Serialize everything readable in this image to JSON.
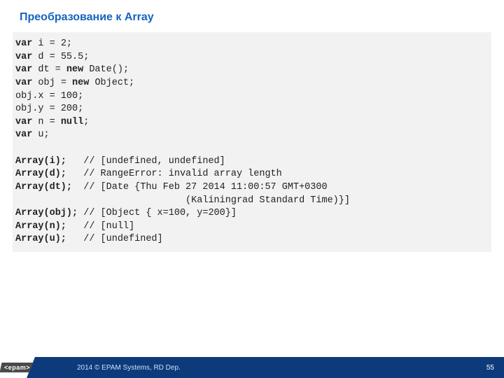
{
  "title": "Преобразование к Array",
  "code": {
    "l1a": "var",
    "l1b": " i = 2;",
    "l2a": "var",
    "l2b": " d = 55.5;",
    "l3a": "var",
    "l3b": " dt = ",
    "l3c": "new",
    "l3d": " Date();",
    "l4a": "var",
    "l4b": " obj = ",
    "l4c": "new",
    "l4d": " Object;",
    "l5": "obj.x = 100;",
    "l6": "obj.y = 200;",
    "l7a": "var",
    "l7b": " n = ",
    "l7c": "null",
    "l7d": ";",
    "l8a": "var",
    "l8b": " u;",
    "blank": " ",
    "a1a": "Array(i);   ",
    "a1b": "// [undefined, undefined]",
    "a2a": "Array(d);   ",
    "a2b": "// RangeError: invalid array length",
    "a3a": "Array(dt);  ",
    "a3b": "// [Date {Thu Feb 27 2014 11:00:57 GMT+0300",
    "a3c": "                              (Kaliningrad Standard Time)}]",
    "a4a": "Array(obj); ",
    "a4b": "// [Object { x=100, y=200}]",
    "a5a": "Array(n);   ",
    "a5b": "// [null]",
    "a6a": "Array(u);   ",
    "a6b": "// [undefined]"
  },
  "footer": {
    "logo": "<epam>",
    "text": "2014 © EPAM Systems, RD Dep.",
    "page": "55"
  }
}
